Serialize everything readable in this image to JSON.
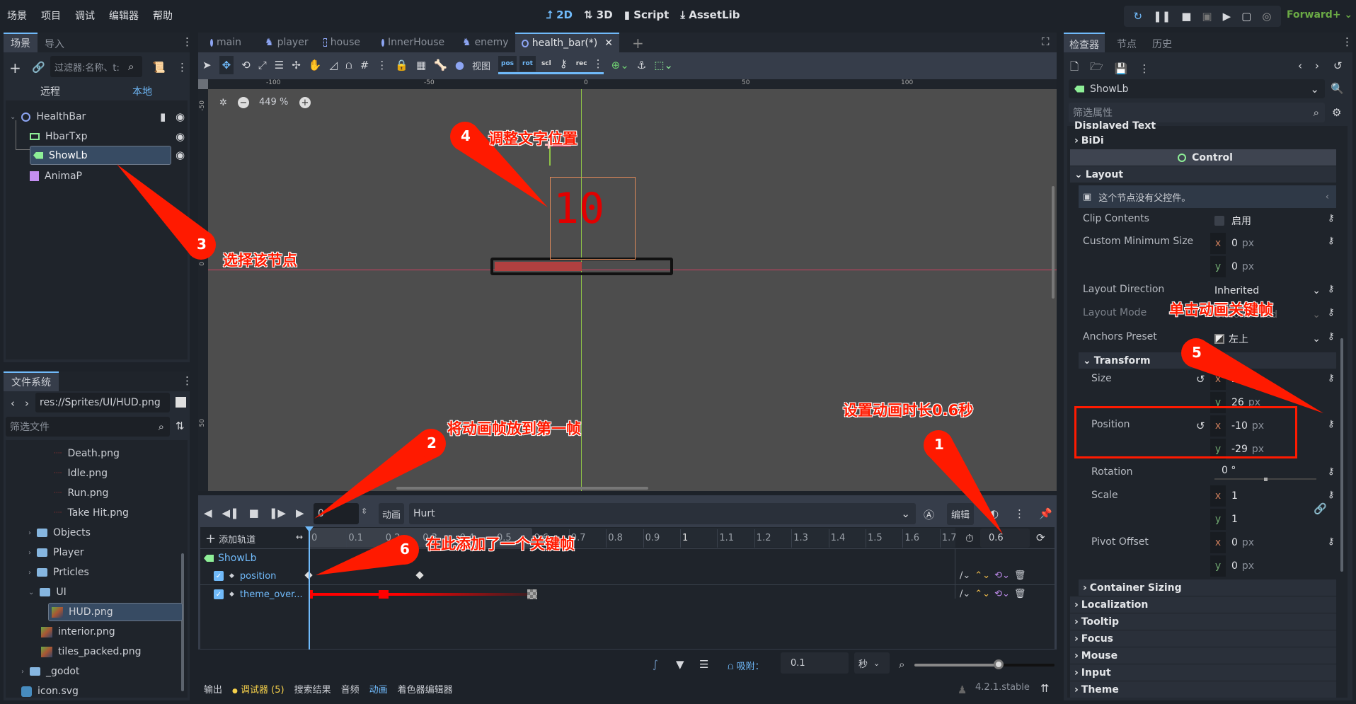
{
  "menu": [
    "场景",
    "项目",
    "调试",
    "编辑器",
    "帮助"
  ],
  "modes": [
    {
      "icon": "2d-icon",
      "label": "2D"
    },
    {
      "icon": "3d-icon",
      "label": "3D"
    },
    {
      "icon": "script-icon",
      "label": "Script"
    },
    {
      "icon": "assetlib-icon",
      "label": "AssetLib"
    }
  ],
  "renderer": "Forward+",
  "scene_dock": {
    "tabs": [
      "场景",
      "导入"
    ],
    "filter_placeholder": "过滤器:名称、t:",
    "remote": "远程",
    "local": "本地",
    "nodes": [
      {
        "name": "HealthBar",
        "icon": "node2d-icon",
        "color": "#8da5f3"
      },
      {
        "name": "HbarTxp",
        "icon": "texture-progress-icon",
        "color": "#8eef97"
      },
      {
        "name": "ShowLb",
        "icon": "label-icon",
        "color": "#8eef97",
        "selected": true
      },
      {
        "name": "AnimaP",
        "icon": "animation-player-icon",
        "color": "#c38ef1"
      }
    ]
  },
  "filesystem": {
    "tab": "文件系统",
    "path": "res://Sprites/UI/HUD.png",
    "filter_placeholder": "筛选文件",
    "items": [
      {
        "name": "Death.png",
        "type": "file"
      },
      {
        "name": "Idle.png",
        "type": "file"
      },
      {
        "name": "Run.png",
        "type": "file"
      },
      {
        "name": "Take Hit.png",
        "type": "file"
      },
      {
        "name": "Objects",
        "type": "folder"
      },
      {
        "name": "Player",
        "type": "folder"
      },
      {
        "name": "Prticles",
        "type": "folder"
      },
      {
        "name": "UI",
        "type": "folder",
        "open": true
      },
      {
        "name": "HUD.png",
        "type": "file",
        "selected": true
      },
      {
        "name": "interior.png",
        "type": "file"
      },
      {
        "name": "tiles_packed.png",
        "type": "file"
      },
      {
        "name": "_godot",
        "type": "folder"
      },
      {
        "name": "icon.svg",
        "type": "file"
      }
    ]
  },
  "editor_tabs": [
    {
      "label": "main",
      "icon": "node2d-icon"
    },
    {
      "label": "player",
      "icon": "character-icon"
    },
    {
      "label": "house",
      "icon": "control-icon"
    },
    {
      "label": "InnerHouse",
      "icon": "node2d-icon"
    },
    {
      "label": "enemy",
      "icon": "character-icon"
    },
    {
      "label": "health_bar(*)",
      "icon": "node2d-icon",
      "active": true
    }
  ],
  "toolbar": {
    "view_label": "视图",
    "pos": "pos",
    "rot": "rot",
    "scl": "scl",
    "rec": "rec"
  },
  "viewport": {
    "zoom": "449 %",
    "ruler_top": [
      "-100",
      "-50",
      "0",
      "50",
      "100"
    ],
    "ruler_left": [
      "-50",
      "0",
      "50"
    ],
    "label_text": "10",
    "healthbar_fill": 0.5
  },
  "animation": {
    "frame": "0",
    "anim_label": "动画",
    "anim_name": "Hurt",
    "edit_label": "编辑",
    "add_track": "添加轨道",
    "ticks": [
      "0",
      "0.1",
      "0.2",
      "0.3",
      "0.4",
      "0.5",
      "0.6",
      "0.7",
      "0.8",
      "0.9",
      "1",
      "1.1",
      "1.2",
      "1.3",
      "1.4",
      "1.5",
      "1.6",
      "1.7"
    ],
    "length": "0.6",
    "node": "ShowLb",
    "tracks": [
      {
        "name": "position",
        "keys": [
          0,
          0.3
        ]
      },
      {
        "name": "theme_over...",
        "keys": [
          0,
          0.2,
          0.6
        ]
      }
    ],
    "snap_label": "吸附：",
    "snap_value": "0.1",
    "snap_unit": "秒",
    "timeline_zoom": 0.6
  },
  "bottom_tabs": [
    "输出",
    "调试器 (5)",
    "搜索结果",
    "音频",
    "动画",
    "着色器编辑器"
  ],
  "version": "4.2.1.stable",
  "inspector": {
    "tabs": [
      "检查器",
      "节点",
      "历史"
    ],
    "node": "ShowLb",
    "filter_placeholder": "筛选属性",
    "displayed_text": "Displayed Text",
    "bidi": "BiDi",
    "class": "Control",
    "layout": "Layout",
    "no_parent": "这个节点没有父控件。",
    "clip_contents": {
      "label": "Clip Contents",
      "value": "启用"
    },
    "custom_min_size": {
      "label": "Custom Minimum Size",
      "x": "0",
      "y": "0",
      "unit": "px"
    },
    "layout_direction": {
      "label": "Layout Direction",
      "value": "Inherited"
    },
    "layout_mode": {
      "label": "Layout Mode",
      "value": "Uncontrolled"
    },
    "anchors_preset": {
      "label": "Anchors Preset",
      "value": "左上"
    },
    "transform": "Transform",
    "size": {
      "label": "Size",
      "x": "27",
      "y": "26",
      "unit": "px"
    },
    "position": {
      "label": "Position",
      "x": "-10",
      "y": "-29",
      "unit": "px"
    },
    "rotation": {
      "label": "Rotation",
      "value": "0 °"
    },
    "scale": {
      "label": "Scale",
      "x": "1",
      "y": "1"
    },
    "pivot_offset": {
      "label": "Pivot Offset",
      "x": "0",
      "y": "0",
      "unit": "px"
    },
    "sections": [
      "Container Sizing",
      "Localization",
      "Tooltip",
      "Focus",
      "Mouse",
      "Input",
      "Theme"
    ]
  },
  "annotations": [
    {
      "num": "1",
      "text": "设置动画时长0.6秒"
    },
    {
      "num": "2",
      "text": "将动画帧放到第一帧"
    },
    {
      "num": "3",
      "text": "选择该节点"
    },
    {
      "num": "4",
      "text": "调整文字位置"
    },
    {
      "num": "5",
      "text": "单击动画关键帧"
    },
    {
      "num": "6",
      "text": "在此添加了一个关键帧"
    }
  ],
  "colors": {
    "accent": "#70bafa",
    "annotation": "#ff1a00",
    "viewport": "#4d4d4d",
    "label_red": "#e00000"
  }
}
